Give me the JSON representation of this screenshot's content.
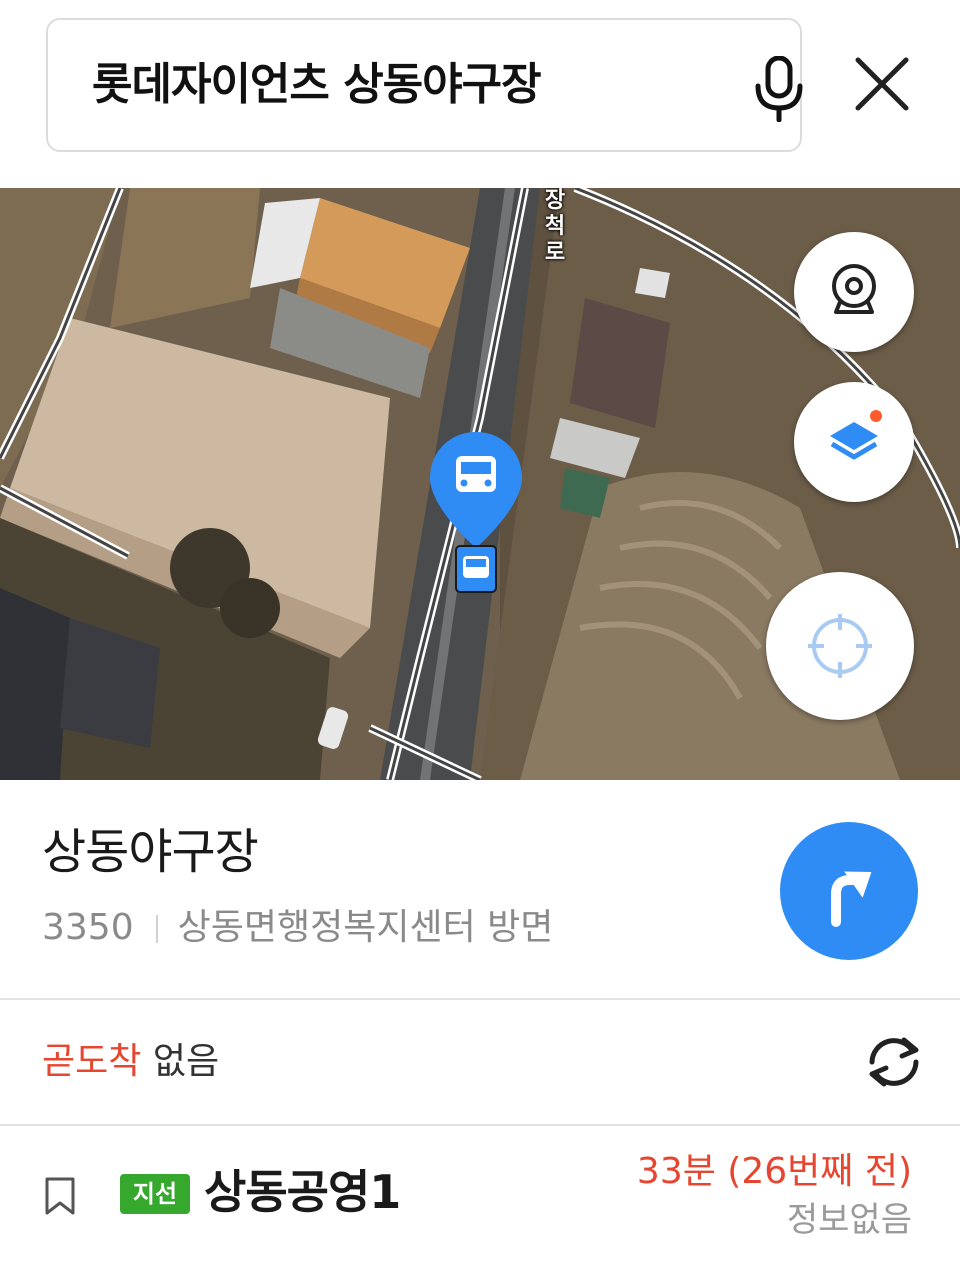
{
  "search": {
    "query": "롯데자이언츠 상동야구장",
    "mic_icon": "microphone-icon",
    "close_icon": "close-icon"
  },
  "map": {
    "road_label": "장척로",
    "buttons": {
      "cctv_icon": "cctv-camera-icon",
      "layer_icon": "layers-icon",
      "locate_icon": "crosshair-icon"
    },
    "marker_icon": "bus-stop-marker-icon",
    "accent_color": "#2f8cf4",
    "layer_dot_color": "#ff5a2a"
  },
  "stop": {
    "name": "상동야구장",
    "id": "3350",
    "direction": "상동면행정복지센터 방면",
    "directions_icon": "turn-right-arrow-icon"
  },
  "arrival_summary": {
    "soon_label": "곧도착",
    "soon_value": "없음",
    "refresh_icon": "refresh-icon"
  },
  "buses": [
    {
      "type_label": "지선",
      "type_color": "#35a82d",
      "number": "상동공영1",
      "arrival": "33분 (26번째 전)",
      "next": "정보없음",
      "bookmark_icon": "bookmark-icon"
    }
  ]
}
